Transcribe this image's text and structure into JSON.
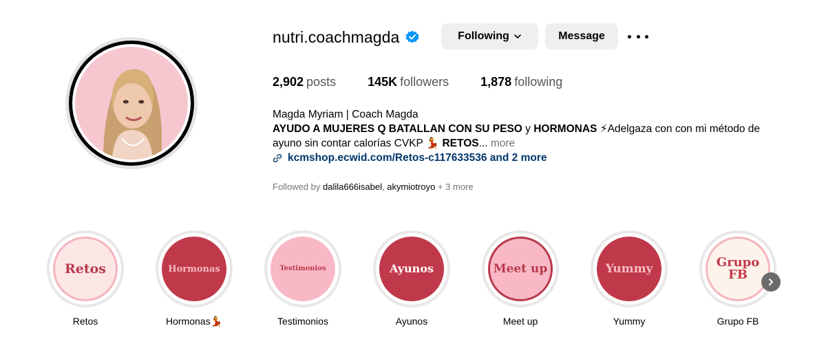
{
  "profile": {
    "username": "nutri.coachmagda",
    "verified_icon": "verified-badge-icon",
    "following_label": "Following",
    "message_label": "Message",
    "more_icon": "more-options-icon"
  },
  "stats": {
    "posts_count": "2,902",
    "posts_label": "posts",
    "followers_count": "145K",
    "followers_label": "followers",
    "following_count": "1,878",
    "following_label": "following"
  },
  "bio": {
    "full_name": "Magda Myriam | Coach Magda",
    "line1_bold_a": "AYUDO A MUJERES Q BATALLAN CON SU PESO",
    "line1_y": " y ",
    "line1_bold_b": "HORMONAS",
    "line1_emoji": "⚡",
    "line1_rest": "Adelgaza con con mi método de",
    "line2_text": "ayuno sin contar calorías CVKP ",
    "line2_emoji": "💃",
    "line2_bold": "RETOS",
    "line2_ellipsis": "... ",
    "more_label": "more",
    "link_text": "kcmshop.ecwid.com/Retos-c117633536 and 2 more",
    "link_icon": "link-icon"
  },
  "followed_by": {
    "prefix": "Followed by ",
    "user1": "dalila666isabel",
    "sep": ", ",
    "user2": "akymiotroyo",
    "suffix": " + 3 more"
  },
  "highlights": [
    {
      "label": "Retos",
      "cover_text": "Retos",
      "cover_color": "#fde6e6",
      "text_color": "#b83a4b"
    },
    {
      "label": "Hormonas💃",
      "cover_text": "Hormonas",
      "cover_color": "#c0394a",
      "text_color": "#f7b9c0"
    },
    {
      "label": "Testimonios",
      "cover_text": "Testimonios",
      "cover_color": "#f9b8c6",
      "text_color": "#b83a4b"
    },
    {
      "label": "Ayunos",
      "cover_text": "Ayunos",
      "cover_color": "#c0394a",
      "text_color": "#ffffff"
    },
    {
      "label": "Meet up",
      "cover_text": "Meet up",
      "cover_color": "#f9b8c6",
      "text_color": "#b83a4b"
    },
    {
      "label": "Yummy",
      "cover_text": "Yummy",
      "cover_color": "#c0394a",
      "text_color": "#f7b9c0"
    },
    {
      "label": "Grupo FB",
      "cover_text": "Grupo\nFB",
      "cover_color": "#fdf3ea",
      "text_color": "#c0394a"
    }
  ],
  "highlights_next_icon": "chevron-right-icon",
  "colors": {
    "button_bg": "#efefef",
    "link": "#00376b",
    "verified": "#0095f6",
    "muted": "#737373"
  }
}
